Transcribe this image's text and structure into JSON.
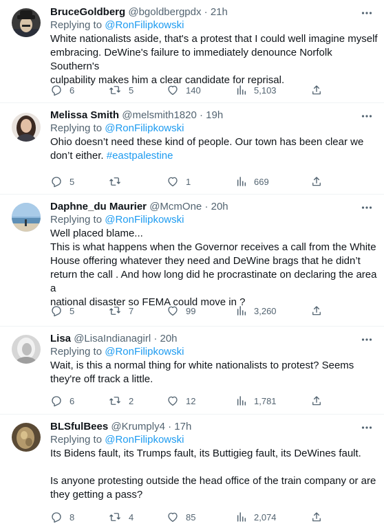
{
  "tweets": [
    {
      "display_name": "BruceGoldberg",
      "handle": "@bgoldbergpdx",
      "time": "21h",
      "replying_prefix": "Replying to",
      "replying_to": "@RonFilipkowski",
      "text_lines": [
        "White nationalists aside, that's a protest that I could well imagine myself",
        "embracing. DeWine's failure to immediately denounce Norfolk Southern's",
        "culpability makes him a clear candidate for reprisal."
      ],
      "replies": "6",
      "retweets": "5",
      "likes": "140",
      "views": "5,103"
    },
    {
      "display_name": "Melissa Smith",
      "handle": "@melsmith1820",
      "time": "19h",
      "replying_prefix": "Replying to",
      "replying_to": "@RonFilipkowski",
      "text_lines": [
        "Ohio doesn’t need these kind of people.  Our town has been clear we"
      ],
      "text_line2_prefix": "don’t either. ",
      "hashtag": "#eastpalestine",
      "replies": "5",
      "retweets": "",
      "likes": "1",
      "views": "669"
    },
    {
      "display_name": "Daphne_du Maurier",
      "handle": "@McmOne",
      "time": "20h",
      "replying_prefix": "Replying to",
      "replying_to": "@RonFilipkowski",
      "text_lines": [
        "Well placed blame...",
        "This is what happens when the Governor receives a call from the White",
        "House offering whatever they need and DeWine brags that he didn’t",
        "return the call . And how long did he procrastinate on declaring the area a",
        "national disaster so FEMA could move in ?"
      ],
      "replies": "5",
      "retweets": "7",
      "likes": "99",
      "views": "3,260"
    },
    {
      "display_name": "Lisa",
      "handle": "@LisaIndianagirl",
      "time": "20h",
      "replying_prefix": "Replying to",
      "replying_to": "@RonFilipkowski",
      "text_lines": [
        "Wait, is this a normal thing for white nationalists to protest? Seems",
        "they're off track a little."
      ],
      "replies": "6",
      "retweets": "2",
      "likes": "12",
      "views": "1,781"
    },
    {
      "display_name": "BLSfulBees",
      "handle": "@Krumply4",
      "time": "17h",
      "replying_prefix": "Replying to",
      "replying_to": "@RonFilipkowski",
      "text_lines": [
        "Its Bidens fault, its Trumps fault, its Buttigieg fault, its DeWines fault.",
        "",
        "Is anyone protesting outside the head office of the train company or are",
        "they getting a pass?"
      ],
      "replies": "8",
      "retweets": "4",
      "likes": "85",
      "views": "2,074"
    }
  ],
  "separator": "·",
  "colors": {
    "text": "#0f1419",
    "secondary": "#536471",
    "link": "#1d9bf0",
    "divider": "#eff3f4"
  }
}
